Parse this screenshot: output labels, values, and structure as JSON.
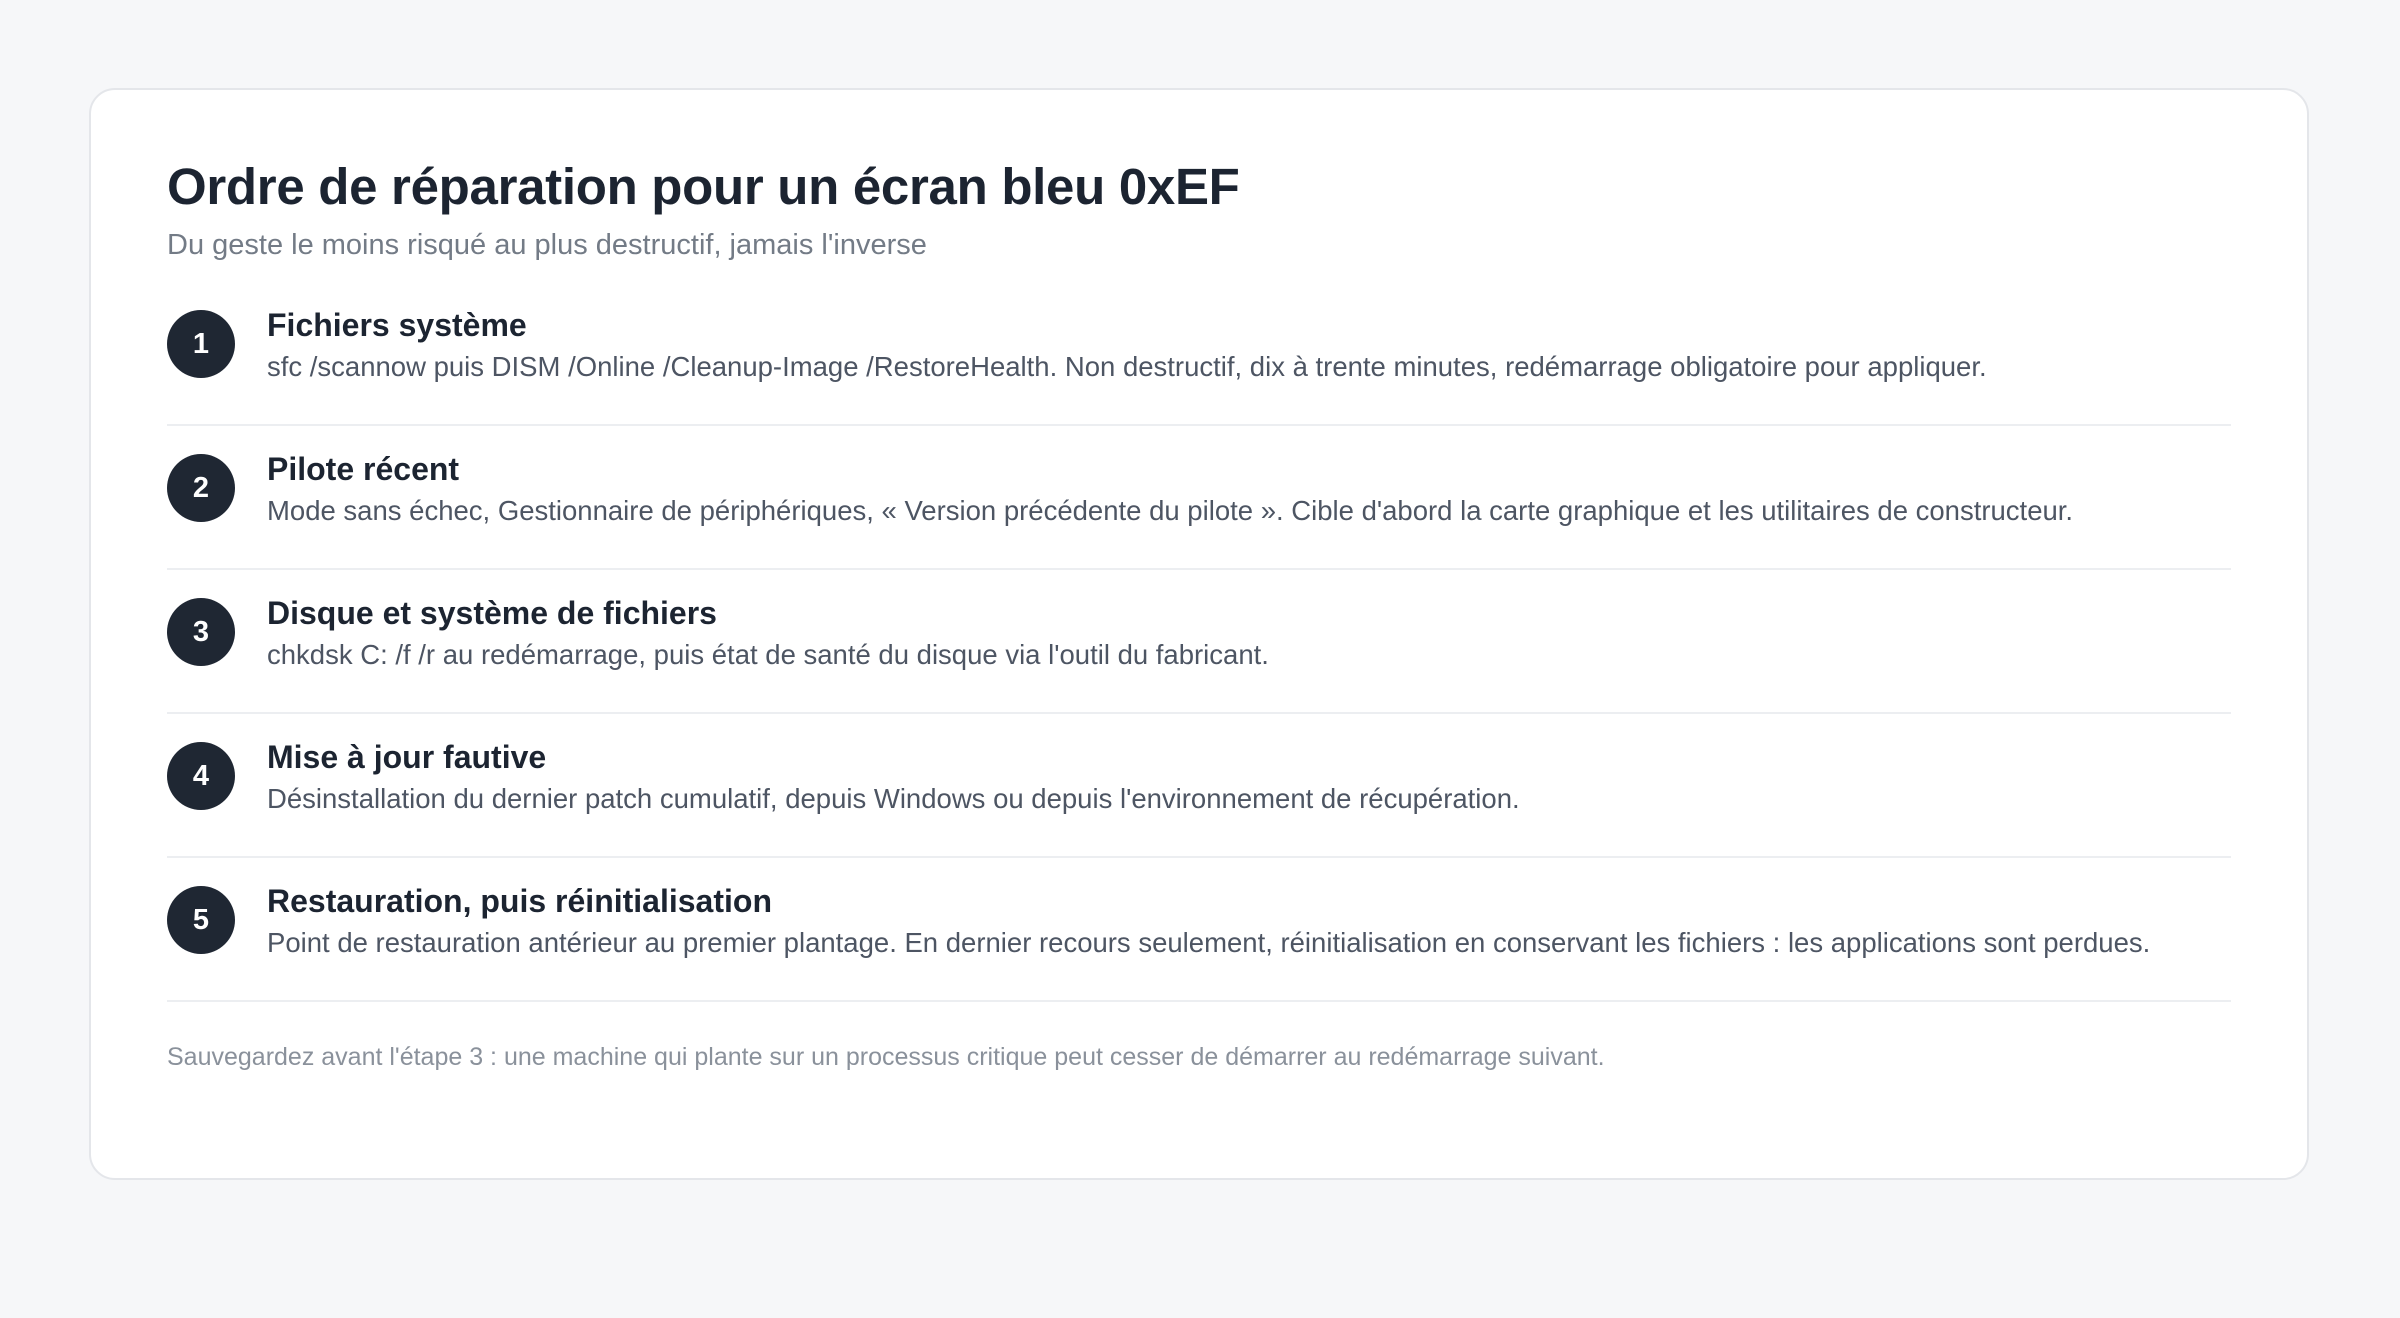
{
  "page": {
    "title": "Ordre de réparation pour un écran bleu 0xEF",
    "subtitle": "Du geste le moins risqué au plus destructif, jamais l'inverse"
  },
  "steps": [
    {
      "number": "1",
      "title": "Fichiers système",
      "description": "sfc /scannow puis DISM /Online /Cleanup-Image /RestoreHealth. Non destructif, dix à trente minutes, redémarrage obligatoire pour appliquer."
    },
    {
      "number": "2",
      "title": "Pilote récent",
      "description": "Mode sans échec, Gestionnaire de périphériques, « Version précédente du pilote ». Cible d'abord la carte graphique et les utilitaires de constructeur."
    },
    {
      "number": "3",
      "title": "Disque et système de fichiers",
      "description": "chkdsk C: /f /r au redémarrage, puis état de santé du disque via l'outil du fabricant."
    },
    {
      "number": "4",
      "title": "Mise à jour fautive",
      "description": "Désinstallation du dernier patch cumulatif, depuis Windows ou depuis l'environnement de récupération."
    },
    {
      "number": "5",
      "title": "Restauration, puis réinitialisation",
      "description": "Point de restauration antérieur au premier plantage. En dernier recours seulement, réinitialisation en conservant les fichiers : les applications sont perdues."
    }
  ],
  "footnote": "Sauvegardez avant l'étape 3 : une machine qui plante sur un processus critique peut cesser de démarrer au redémarrage suivant.",
  "colors": {
    "badge": "#1f2733",
    "title": "#1c2431",
    "muted": "#737b86",
    "background": "#f6f7f9"
  }
}
